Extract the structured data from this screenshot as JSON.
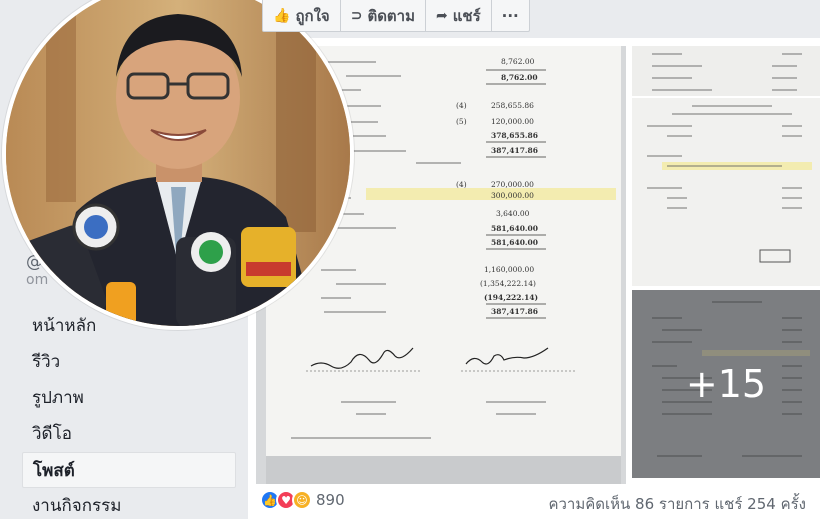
{
  "action_bar": {
    "like_label": "ถูกใจ",
    "follow_label": "ติดตาม",
    "share_label": "แชร์",
    "more_label": "···"
  },
  "sidebar": {
    "handle_fragment": "@",
    "handle_fragment2": "om",
    "items": [
      {
        "label": "หน้าหลัก",
        "active": false
      },
      {
        "label": "รีวิว",
        "active": false
      },
      {
        "label": "รูปภาพ",
        "active": false
      },
      {
        "label": "วิดีโอ",
        "active": false
      },
      {
        "label": "โพสต์",
        "active": true
      },
      {
        "label": "งานกิจกรรม",
        "active": false
      }
    ]
  },
  "post": {
    "more_photos": "+15",
    "reaction_count": "890",
    "comments_text": "ความคิดเห็น 86 รายการ",
    "shares_text": "แชร์ 254 ครั้ง",
    "document_figures": [
      "8,762.00",
      "8,762.00",
      "258,655.86",
      "120,000.00",
      "378,655.86",
      "387,417.86",
      "270,000.00",
      "300,000.00",
      "3,640.00",
      "581,640.00",
      "581,640.00",
      "1,160,000.00",
      "(1,354,222.14)",
      "(194,222.14)",
      "387,417.86"
    ],
    "document_notes": [
      "(4)",
      "(5)",
      "(4)"
    ]
  },
  "colors": {
    "accent": "#4267b2",
    "like": "#2078f4",
    "love": "#f33e58",
    "haha": "#f7b125",
    "highlight": "#f3ecb0"
  }
}
